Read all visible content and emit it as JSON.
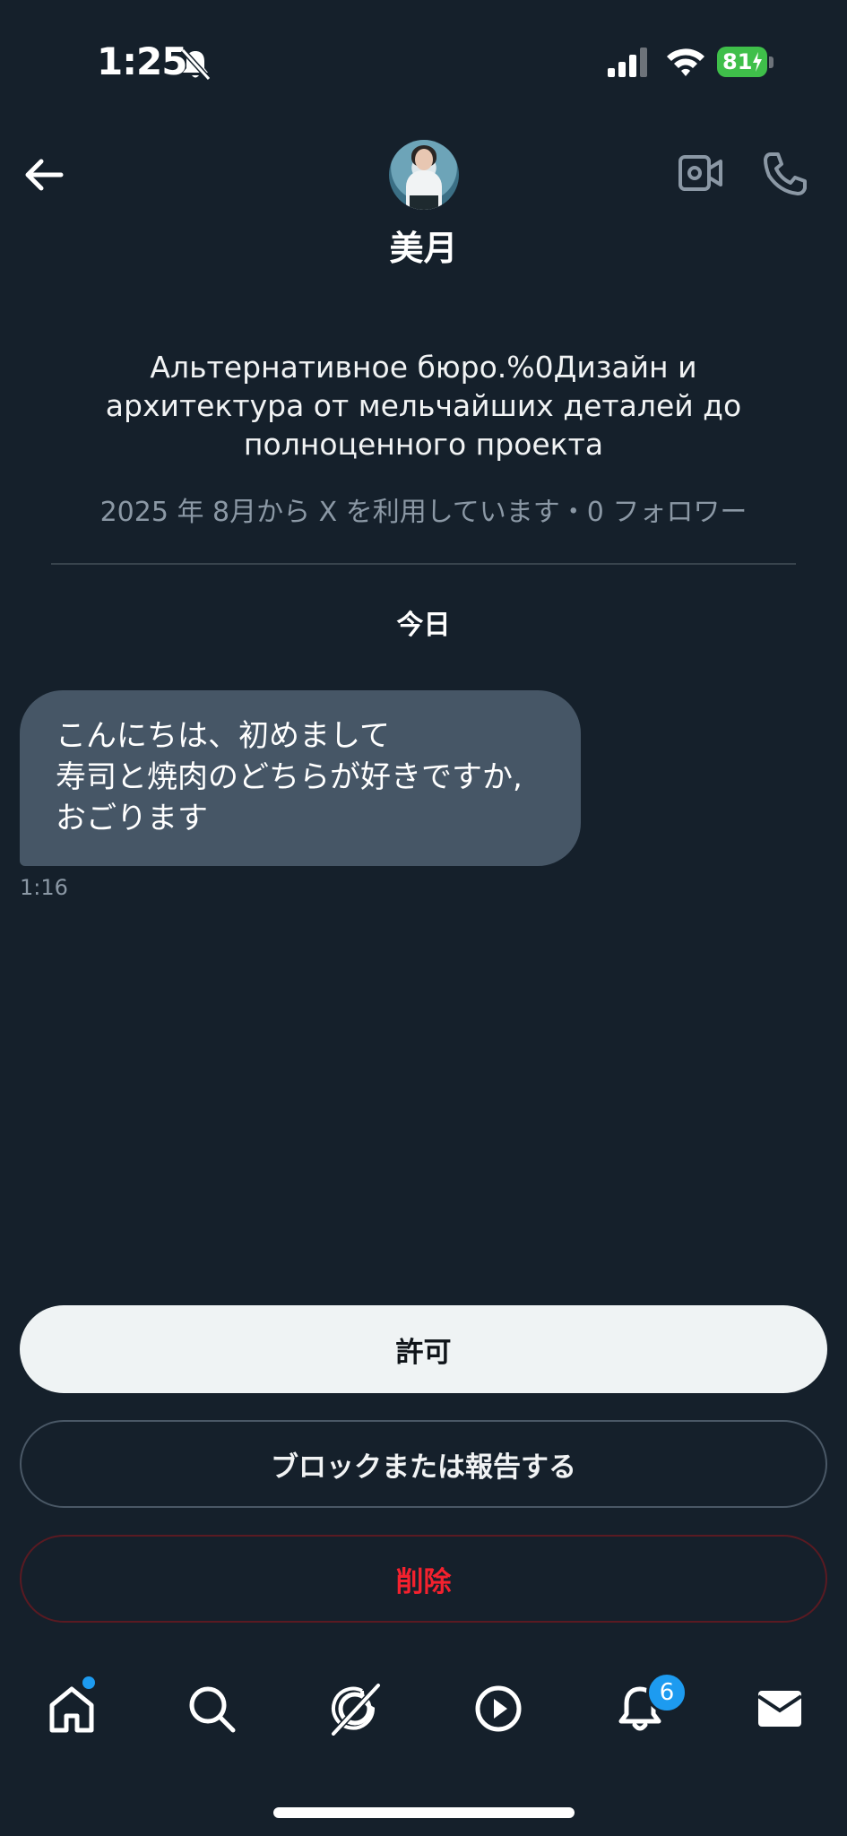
{
  "status_bar": {
    "time": "1:25",
    "battery_level": "81",
    "icons": [
      "bell-off-icon",
      "cellular-signal-icon",
      "wifi-icon",
      "battery-charging-icon"
    ]
  },
  "header": {
    "username": "美月",
    "icons": [
      "back-arrow-icon",
      "avatar",
      "video-call-icon",
      "phone-call-icon"
    ]
  },
  "profile": {
    "bio_lines": [
      "Альтернативное бюро.%0Дизайн и",
      "архитектура от мельчайших деталей до",
      "полноценного проекта"
    ],
    "meta": "2025 年 8月から X を利用しています・0 フォロワー"
  },
  "conversation": {
    "day_label": "今日",
    "messages": [
      {
        "lines": [
          "こんにちは、初めまして",
          "寿司と焼肉のどちらが好きですか,",
          "おごります"
        ],
        "time": "1:16"
      }
    ]
  },
  "actions": {
    "allow": "許可",
    "block_or_report": "ブロックまたは報告する",
    "delete": "削除"
  },
  "tab_bar": {
    "items": [
      "home-icon",
      "search-icon",
      "grok-icon",
      "video-icon",
      "notifications-icon",
      "messages-icon"
    ],
    "notifications_badge": "6"
  },
  "colors": {
    "background": "#15202b",
    "bubble": "#465666",
    "accent": "#1d9bf0",
    "danger": "#f4212e",
    "muted_text": "#8b98a5"
  }
}
